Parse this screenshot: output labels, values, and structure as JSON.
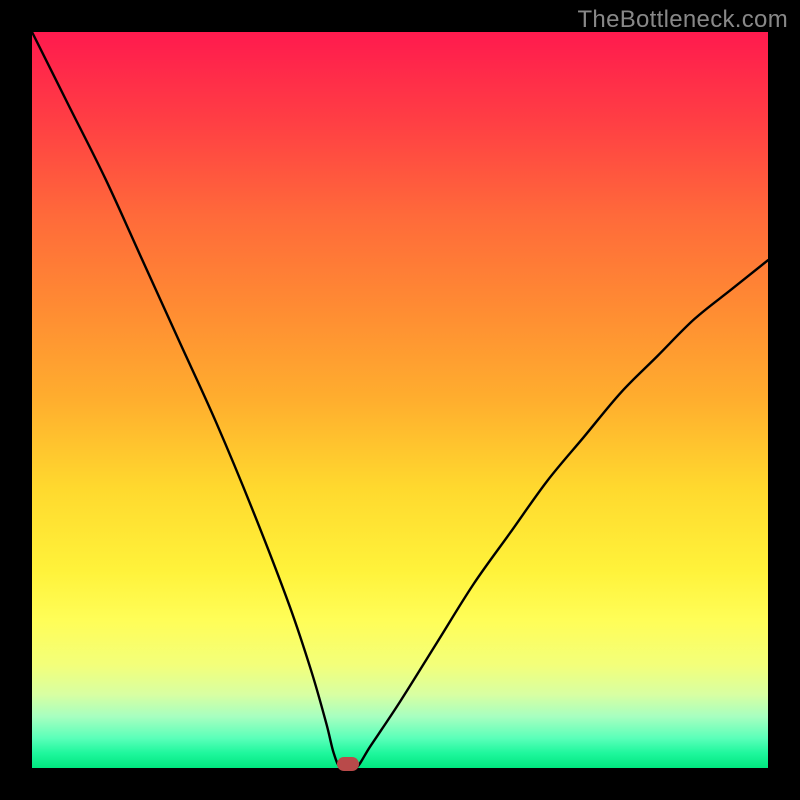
{
  "watermark": "TheBottleneck.com",
  "chart_data": {
    "type": "line",
    "title": "",
    "xlabel": "",
    "ylabel": "",
    "xlim": [
      0,
      100
    ],
    "ylim": [
      0,
      100
    ],
    "series": [
      {
        "name": "curve",
        "x": [
          0,
          5,
          10,
          15,
          20,
          25,
          30,
          35,
          38,
          40,
          41,
          42,
          44,
          46,
          50,
          55,
          60,
          65,
          70,
          75,
          80,
          85,
          90,
          95,
          100
        ],
        "values": [
          100,
          90,
          80,
          69,
          58,
          47,
          35,
          22,
          13,
          6,
          2,
          0,
          0,
          3,
          9,
          17,
          25,
          32,
          39,
          45,
          51,
          56,
          61,
          65,
          69
        ]
      }
    ],
    "marker": {
      "x": 43,
      "y": 0,
      "color": "#b94a4a"
    },
    "gradient_stops": [
      {
        "pos": 0,
        "color": "#ff1a4e"
      },
      {
        "pos": 50,
        "color": "#ffd92e"
      },
      {
        "pos": 100,
        "color": "#00e77f"
      }
    ]
  }
}
